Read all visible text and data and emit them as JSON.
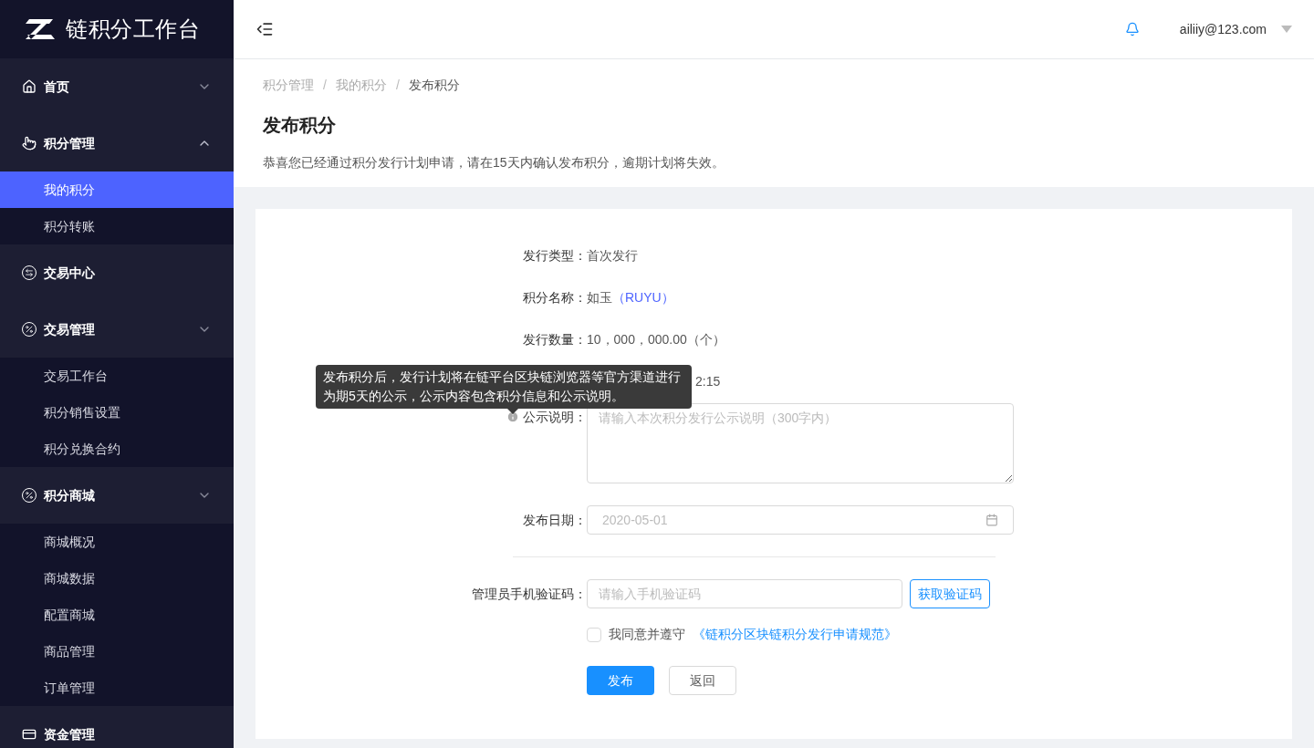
{
  "sidebar": {
    "logo": "链积分工作台",
    "groups": [
      {
        "label": "首页",
        "expanded": false
      },
      {
        "label": "积分管理",
        "expanded": true,
        "children": [
          {
            "label": "我的积分",
            "selected": true
          },
          {
            "label": "积分转账",
            "selected": false
          }
        ]
      },
      {
        "label": "交易中心"
      },
      {
        "label": "交易管理",
        "expanded": false,
        "children": [
          {
            "label": "交易工作台",
            "selected": false
          },
          {
            "label": "积分销售设置",
            "selected": false
          },
          {
            "label": "积分兑换合约",
            "selected": false
          }
        ]
      },
      {
        "label": "积分商城",
        "expanded": false,
        "children": [
          {
            "label": "商城概况",
            "selected": false
          },
          {
            "label": "商城数据",
            "selected": false
          },
          {
            "label": "配置商城",
            "selected": false
          },
          {
            "label": "商品管理",
            "selected": false
          },
          {
            "label": "订单管理",
            "selected": false
          }
        ]
      },
      {
        "label": "资金管理"
      }
    ]
  },
  "header": {
    "user": "ailiiy@123.com"
  },
  "breadcrumb": [
    {
      "kind": "link",
      "text": "积分管理"
    },
    {
      "kind": "separator",
      "text": "/"
    },
    {
      "kind": "link",
      "text": "我的积分"
    },
    {
      "kind": "separator",
      "text": "/"
    },
    {
      "kind": "current",
      "text": "发布积分"
    }
  ],
  "page": {
    "title": "发布积分",
    "notice": "恭喜您已经通过积分发行计划申请，请在15天内确认发布积分，逾期计划将失效。"
  },
  "form": {
    "rows": [
      {
        "label": "发行类型：",
        "value": "首次发行"
      },
      {
        "label": "积分名称：",
        "value": "如玉",
        "code": "（RUYU）"
      },
      {
        "label": "发行数量：",
        "value": "10，000，000.00（个）"
      },
      {
        "value": "2:15"
      }
    ],
    "tooltip": "发布积分后，发行计划将在链平台区块链浏览器等官方渠道进行为期5天的公示，公示内容包含积分信息和公示说明。",
    "notice_label": "公示说明：",
    "notice_placeholder": "请输入本次积分发行公示说明（300字内）",
    "date_label": "发布日期：",
    "date_placeholder": "2020-05-01",
    "code_label": "管理员手机验证码：",
    "code_placeholder": "请输入手机验证码",
    "code_button": "获取验证码",
    "agree": {
      "checked": false,
      "text": "我同意并遵守",
      "link": "《链积分区块链积分发行申请规范》"
    },
    "buttons": [
      "发布",
      "返回"
    ]
  }
}
